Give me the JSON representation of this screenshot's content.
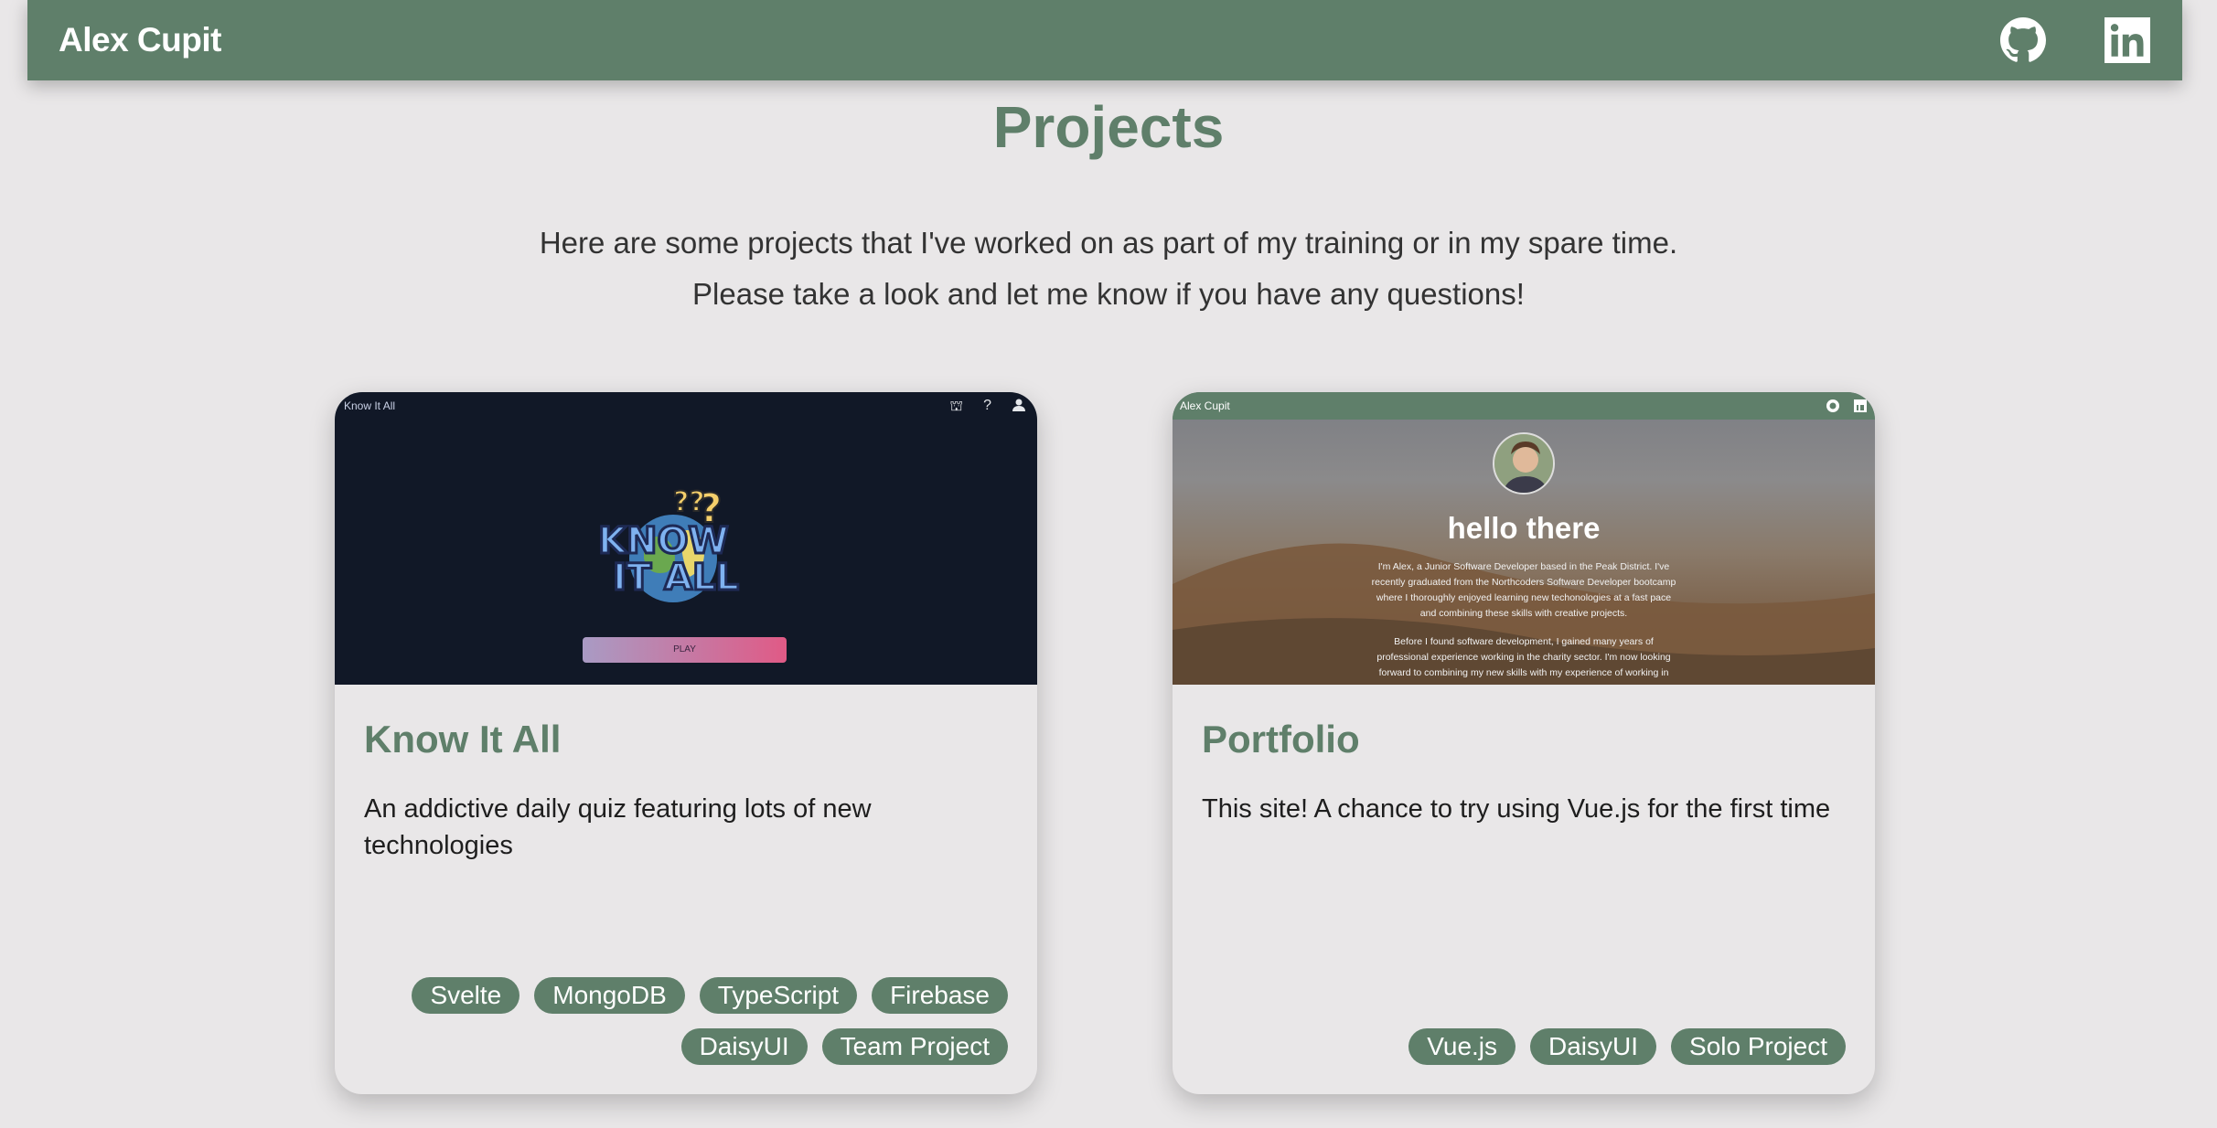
{
  "header": {
    "brand": "Alex Cupit",
    "icons": [
      "github-icon",
      "linkedin-icon"
    ]
  },
  "page": {
    "title": "Projects",
    "intro_line1": "Here are some projects that I've worked on as part of my training or in my spare time.",
    "intro_line2": "Please take a look and let me know if you have any questions!"
  },
  "projects": [
    {
      "title": "Know It All",
      "description": "An addictive daily quiz featuring lots of new technologies",
      "tags": [
        "Svelte",
        "MongoDB",
        "TypeScript",
        "Firebase",
        "DaisyUI",
        "Team Project"
      ],
      "preview": {
        "brand": "Know It All",
        "play_label": "PLAY"
      }
    },
    {
      "title": "Portfolio",
      "description": "This site! A chance to try using Vue.js for the first time",
      "tags": [
        "Vue.js",
        "DaisyUI",
        "Solo Project"
      ],
      "preview": {
        "brand": "Alex Cupit",
        "heading": "hello there",
        "para1": "I'm Alex, a Junior Software Developer based in the Peak District. I've recently graduated from the Northcoders Software Developer bootcamp where I thoroughly enjoyed learning new techonologies at a fast pace and combining these skills with creative projects.",
        "para2": "Before I found software development, I gained many years of professional experience working in the charity sector. I'm now looking forward to combining my new skills with my experience of working in"
      }
    }
  ],
  "colors": {
    "accent": "#5f7f6a",
    "background": "#e9e7e8"
  }
}
